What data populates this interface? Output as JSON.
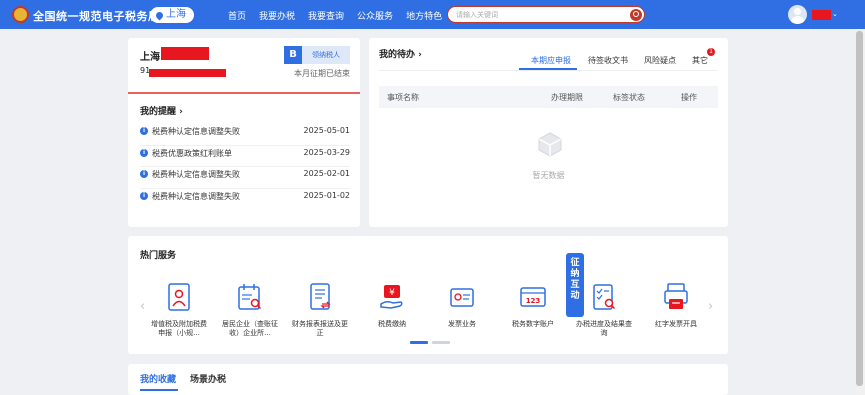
{
  "header": {
    "site_title": "全国统一规范电子税务局",
    "region": "上海",
    "nav": [
      "首页",
      "我要办税",
      "我要查询",
      "公众服务",
      "地方特色"
    ],
    "search_placeholder": "请输入关键词",
    "brand_color": "#2f6fe3",
    "accent_color": "#c0392b"
  },
  "account": {
    "company_prefix": "上海",
    "taxid_prefix": "91",
    "taxpayer_badge": "B",
    "taxpayer_level": "领纳税人",
    "period_status": "本月征期已结束"
  },
  "reminders": {
    "title": "我的提醒",
    "items": [
      {
        "text": "税费种认定信息调整失败",
        "date": "2025-05-01"
      },
      {
        "text": "税费优惠政策红利账单",
        "date": "2025-03-29"
      },
      {
        "text": "税费种认定信息调整失败",
        "date": "2025-02-01"
      },
      {
        "text": "税费种认定信息调整失败",
        "date": "2025-01-02"
      }
    ]
  },
  "todo": {
    "title": "我的待办",
    "tabs": [
      "本期应申报",
      "待签收文书",
      "风险疑点",
      "其它"
    ],
    "other_badge": "1",
    "columns": [
      "事项名称",
      "办理期限",
      "标签状态",
      "操作"
    ],
    "empty_text": "暂无数据"
  },
  "hot_services": {
    "title": "热门服务",
    "items": [
      {
        "label": "增值税及附加税费申报（小规...",
        "icon": "person-doc-icon"
      },
      {
        "label": "居民企业（查账征收）企业所...",
        "icon": "calendar-search-icon"
      },
      {
        "label": "财务报表报送及更正",
        "icon": "report-icon"
      },
      {
        "label": "税费缴纳",
        "icon": "payment-hand-icon"
      },
      {
        "label": "发票业务",
        "icon": "invoice-icon"
      },
      {
        "label": "税务数字账户",
        "icon": "digital-account-icon"
      },
      {
        "label": "办税进度及结果查询",
        "icon": "progress-check-icon"
      },
      {
        "label": "红字发票开具",
        "icon": "red-invoice-icon"
      }
    ],
    "float_badge": "征纳互动"
  },
  "favorites": {
    "tabs": [
      "我的收藏",
      "场景办税"
    ]
  }
}
